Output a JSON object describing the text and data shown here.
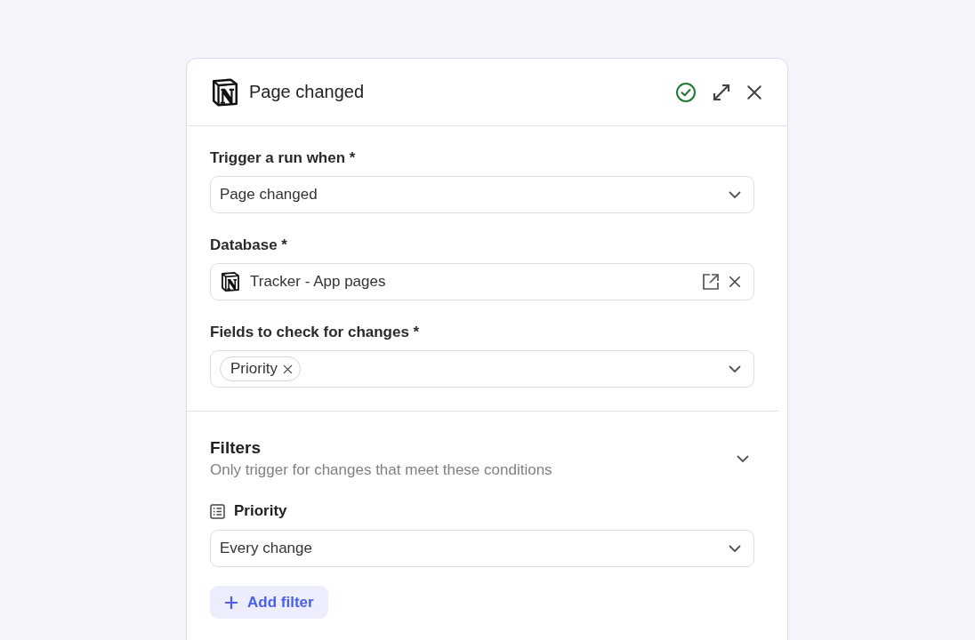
{
  "header": {
    "title": "Page changed"
  },
  "fields": [
    {
      "label": "Trigger a run when *",
      "kind": "select",
      "value": "Page changed"
    },
    {
      "label": "Database *",
      "kind": "database",
      "value": "Tracker - App pages"
    },
    {
      "label": "Fields to check for changes *",
      "kind": "tags",
      "tags": [
        "Priority"
      ]
    }
  ],
  "filters": {
    "title": "Filters",
    "description": "Only trigger for changes that meet these conditions",
    "rules": [
      {
        "field": "Priority",
        "value": "Every change"
      }
    ],
    "add_button": "Add filter"
  }
}
